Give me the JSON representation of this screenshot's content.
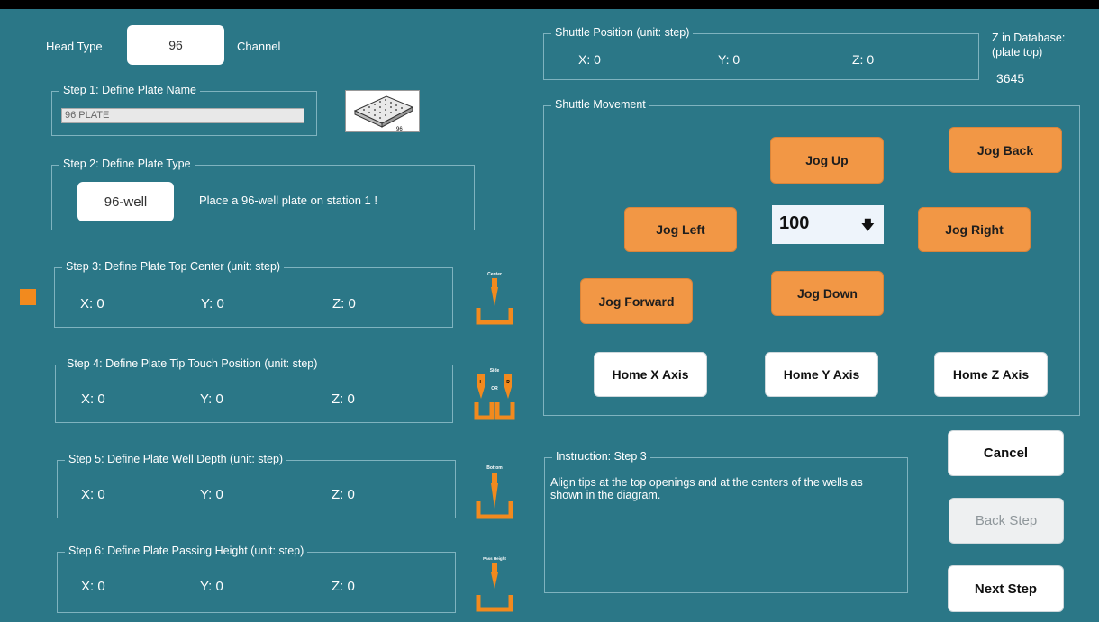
{
  "head": {
    "label": "Head Type",
    "value": "96",
    "unit": "Channel"
  },
  "step1": {
    "title": "Step 1: Define Plate Name",
    "name_value": "96 PLATE",
    "plate_label": "96"
  },
  "step2": {
    "title": "Step 2: Define Plate Type",
    "type_value": "96-well",
    "message": "Place a 96-well plate on station 1 !"
  },
  "step3": {
    "title": "Step 3: Define Plate Top Center (unit: step)",
    "x": "X:  0",
    "y": "Y:  0",
    "z": "Z:  0",
    "icon_label": "Center"
  },
  "step4": {
    "title": "Step 4: Define Plate Tip Touch Position (unit: step)",
    "x": "X:  0",
    "y": "Y:  0",
    "z": "Z:  0",
    "icon_label": "Side",
    "icon_l": "L",
    "icon_r": "R",
    "icon_or": "OR"
  },
  "step5": {
    "title": "Step 5: Define Plate Well Depth (unit: step)",
    "x": "X:  0",
    "y": "Y:  0",
    "z": "Z:  0",
    "icon_label": "Bottom"
  },
  "step6": {
    "title": "Step 6: Define Plate Passing Height (unit: step)",
    "x": "X:  0",
    "y": "Y:  0",
    "z": "Z:  0",
    "icon_label": "Pass Height"
  },
  "shuttle_position": {
    "title": "Shuttle Position (unit: step)",
    "x": "X: 0",
    "y": "Y: 0",
    "z": "Z: 0"
  },
  "z_database": {
    "label_line1": "Z in Database:",
    "label_line2": "(plate top)",
    "value": "3645"
  },
  "movement": {
    "title": "Shuttle Movement",
    "jog_up": "Jog Up",
    "jog_back": "Jog Back",
    "jog_left": "Jog Left",
    "jog_right": "Jog Right",
    "jog_forward": "Jog Forward",
    "jog_down": "Jog Down",
    "step_value": "100",
    "step_arrow": "🡇",
    "home_x": "Home X Axis",
    "home_y": "Home Y Axis",
    "home_z": "Home Z Axis"
  },
  "instruction": {
    "title": "Instruction: Step 3",
    "text": "Align tips at the top openings and at the centers of the wells as shown in the diagram."
  },
  "buttons": {
    "cancel": "Cancel",
    "back": "Back Step",
    "next": "Next Step"
  },
  "colors": {
    "background": "#2b7787",
    "orange": "#f29745",
    "indicator": "#f28a1e"
  }
}
